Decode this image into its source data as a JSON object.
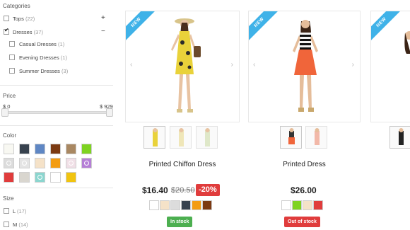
{
  "filters": {
    "categories": {
      "title": "Categories",
      "items": [
        {
          "label": "Tops",
          "count": "(22)",
          "checked": false,
          "toggle": "+"
        },
        {
          "label": "Dresses",
          "count": "(37)",
          "checked": true,
          "toggle": "−"
        }
      ],
      "subitems": [
        {
          "label": "Casual Dresses",
          "count": "(1)"
        },
        {
          "label": "Evening Dresses",
          "count": "(1)"
        },
        {
          "label": "Summer Dresses",
          "count": "(3)"
        }
      ]
    },
    "price": {
      "title": "Price",
      "min_label": "$ 0",
      "max_label": "$ 929",
      "range_low_fraction": 0,
      "range_high_fraction": 1
    },
    "color": {
      "title": "Color",
      "swatches": [
        {
          "name": "white",
          "hex": "#f8f8f2"
        },
        {
          "name": "dark-blue",
          "hex": "#37424e"
        },
        {
          "name": "blue",
          "hex": "#5f87c4"
        },
        {
          "name": "brown",
          "hex": "#7c3a12"
        },
        {
          "name": "taupe",
          "hex": "#a98862"
        },
        {
          "name": "green",
          "hex": "#7ed321"
        },
        {
          "name": "grey-pattern",
          "hex": "#dcdcdc"
        },
        {
          "name": "grey-pattern-2",
          "hex": "#e4e4e4"
        },
        {
          "name": "beige",
          "hex": "#f5e2c8"
        },
        {
          "name": "orange",
          "hex": "#f39c12"
        },
        {
          "name": "pink-pattern",
          "hex": "#f0dfe6"
        },
        {
          "name": "purple-pattern",
          "hex": "#b57fd6"
        },
        {
          "name": "red",
          "hex": "#e03c3c"
        },
        {
          "name": "light-grey",
          "hex": "#d9d6cf"
        },
        {
          "name": "teal-pattern",
          "hex": "#8bd6cf"
        },
        {
          "name": "white-2",
          "hex": "#ffffff"
        },
        {
          "name": "yellow",
          "hex": "#f1c40f"
        }
      ]
    },
    "size": {
      "title": "Size",
      "items": [
        {
          "label": "L",
          "count": "(17)"
        },
        {
          "label": "M",
          "count": "(14)"
        }
      ]
    }
  },
  "products": [
    {
      "badge": "NEW",
      "name": "Printed Chiffon Dress",
      "price": "$16.40",
      "old_price": "$20.50",
      "discount": "-20%",
      "stock": "In stock",
      "stock_status": "in",
      "dress_color": "#e9d23a",
      "colors": [
        "#ffffff",
        "#f5e2c8",
        "#dcdcdc",
        "#37424e",
        "#f39c12",
        "#7c3a12"
      ]
    },
    {
      "badge": "NEW",
      "name": "Printed Dress",
      "price": "$26.00",
      "stock": "Out of stock",
      "stock_status": "out",
      "dress_color": "#f0653a",
      "colors": [
        "#ffffff",
        "#7ed321",
        "#f5e2c8",
        "#e03c3c"
      ]
    },
    {
      "badge": "NEW",
      "dress_color": "#222222"
    }
  ],
  "nav": {
    "prev_icon": "‹",
    "next_icon": "›"
  }
}
